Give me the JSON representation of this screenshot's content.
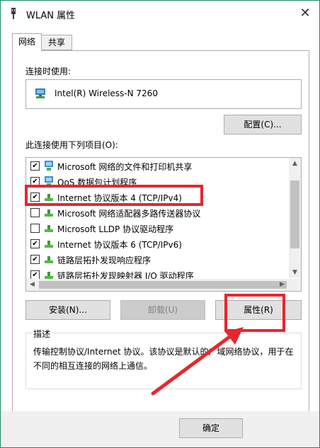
{
  "window": {
    "title": "WLAN 属性",
    "close_glyph": "✕"
  },
  "tabs": [
    {
      "label": "网络",
      "active": true
    },
    {
      "label": "共享",
      "active": false
    }
  ],
  "connect_using_label": "连接时使用:",
  "adapter": {
    "name": "Intel(R) Wireless-N 7260",
    "icon": "network-adapter-icon"
  },
  "configure_button": "配置(C)...",
  "items_label": "此连接使用下列项目(O):",
  "items": [
    {
      "label": "Microsoft 网络的文件和打印机共享",
      "checked": true,
      "icon": "network-service-icon"
    },
    {
      "label": "QoS 数据包计划程序",
      "checked": true,
      "icon": "network-service-icon"
    },
    {
      "label": "Internet 协议版本 4 (TCP/IPv4)",
      "checked": true,
      "icon": "protocol-icon"
    },
    {
      "label": "Microsoft 网络适配器多路传送器协议",
      "checked": false,
      "icon": "protocol-icon"
    },
    {
      "label": "Microsoft LLDP 协议驱动程序",
      "checked": false,
      "icon": "protocol-icon"
    },
    {
      "label": "Internet 协议版本 6 (TCP/IPv6)",
      "checked": true,
      "icon": "protocol-icon"
    },
    {
      "label": "链路层拓扑发现响应程序",
      "checked": true,
      "icon": "protocol-icon"
    },
    {
      "label": "链路层拓扑发现映射器 I/O 驱动程序",
      "checked": true,
      "icon": "protocol-icon"
    }
  ],
  "buttons": {
    "install": "安装(N)...",
    "uninstall": "卸载(U)",
    "properties": "属性(R)",
    "ok": "确定"
  },
  "description": {
    "title": "描述",
    "text": "传输控制协议/Internet 协议。该协议是默认的广域网络协议，用于在不同的相互连接的网络上通信。"
  },
  "colors": {
    "accent_border": "#1e8a6a",
    "highlight_red": "#e8262d"
  }
}
